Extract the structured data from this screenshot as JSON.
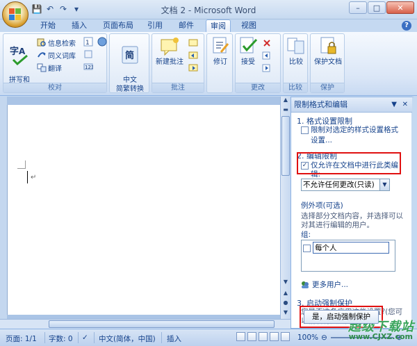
{
  "window": {
    "title": "文档 2 - Microsoft Word",
    "controls": [
      "–",
      "□",
      "✕"
    ]
  },
  "qat": [
    "💾",
    "↶",
    "↷",
    "▾"
  ],
  "tabs": [
    "开始",
    "插入",
    "页面布局",
    "引用",
    "邮件",
    "审阅",
    "视图"
  ],
  "active_tab": "审阅",
  "help": "?",
  "ribbon": {
    "proofing": {
      "label": "校对",
      "spelling": "拼写和\n语法",
      "research": "信息检索",
      "thesaurus": "同义词库",
      "translate": "翻译"
    },
    "chinese": {
      "label": "中文\n简繁转换",
      "button": "中文\n简繁转换"
    },
    "comments": {
      "label": "批注",
      "new_comment": "新建批注"
    },
    "tracking": {
      "label": "修订",
      "button": "修订"
    },
    "changes": {
      "label": "更改",
      "accept": "接受"
    },
    "compare": {
      "label": "比较",
      "button": "比较"
    },
    "protect": {
      "label": "保护",
      "button": "保护文档"
    }
  },
  "pane": {
    "title": "限制格式和编辑",
    "dropdown_icon": "▼",
    "close_icon": "✕",
    "section1": {
      "title": "1.  格式设置限制",
      "checkbox": "限制对选定的样式设置格式",
      "link": "设置..."
    },
    "section2": {
      "title": "2.  编辑限制",
      "checkbox": "仅允许在文档中进行此类编辑:",
      "checked": "✓",
      "select_value": "不允许任何更改(只读)"
    },
    "exceptions": {
      "title": "例外项(可选)",
      "desc": "选择部分文档内容，并选择可以对其进行编辑的用户。",
      "group_label": "组:",
      "everyone": "每个人",
      "more_users": "更多用户..."
    },
    "section3": {
      "title": "3.  启动强制保护",
      "question": "您是否准备应用这些设置?(您可以稍后将其关闭)",
      "button": "是，启动强制保护"
    }
  },
  "status": {
    "page": "页面: 1/1",
    "words": "字数: 0",
    "language": "中文(简体，中国)",
    "insert": "插入",
    "zoom": "100%"
  },
  "watermark": {
    "line1": "超级下载站",
    "line2": "www.CJXZ.com"
  },
  "colors": {
    "accent": "#15428b",
    "highlight_box": "#e01010",
    "ribbon_bg": "#dbe7f7"
  }
}
